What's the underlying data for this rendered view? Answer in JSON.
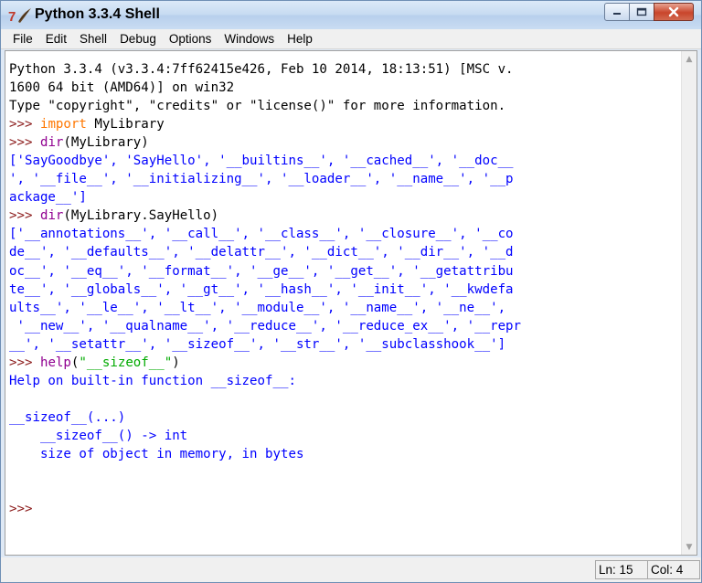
{
  "window": {
    "title": "Python 3.3.4 Shell",
    "icon": "python-tk-feather-icon",
    "controls": [
      "minimize-icon",
      "maximize-icon",
      "close-icon"
    ]
  },
  "menu": [
    "File",
    "Edit",
    "Shell",
    "Debug",
    "Options",
    "Windows",
    "Help"
  ],
  "colors": {
    "keyword": "#ff7700",
    "builtin": "#900090",
    "string": "#00aa00",
    "stdout": "#0000ff",
    "prompt": "#8b1a1a"
  },
  "console": {
    "lines": [
      [
        {
          "t": "Python 3.3.4 (v3.3.4:7ff62415e426, Feb 10 2014, 18:13:51) [MSC v.",
          "c": "default"
        }
      ],
      [
        {
          "t": "1600 64 bit (AMD64)] on win32",
          "c": "default"
        }
      ],
      [
        {
          "t": "Type \"copyright\", \"credits\" or \"license()\" for more information.",
          "c": "default"
        }
      ],
      [
        {
          "t": ">>> ",
          "c": "prompt"
        },
        {
          "t": "import",
          "c": "kw"
        },
        {
          "t": " MyLibrary",
          "c": "default"
        }
      ],
      [
        {
          "t": ">>> ",
          "c": "prompt"
        },
        {
          "t": "dir",
          "c": "builtin"
        },
        {
          "t": "(MyLibrary)",
          "c": "default"
        }
      ],
      [
        {
          "t": "['SayGoodbye', 'SayHello', '__builtins__', '__cached__', '__doc__",
          "c": "stdout"
        }
      ],
      [
        {
          "t": "', '__file__', '__initializing__', '__loader__', '__name__', '__p",
          "c": "stdout"
        }
      ],
      [
        {
          "t": "ackage__']",
          "c": "stdout"
        }
      ],
      [
        {
          "t": ">>> ",
          "c": "prompt"
        },
        {
          "t": "dir",
          "c": "builtin"
        },
        {
          "t": "(MyLibrary.SayHello)",
          "c": "default"
        }
      ],
      [
        {
          "t": "['__annotations__', '__call__', '__class__', '__closure__', '__co",
          "c": "stdout"
        }
      ],
      [
        {
          "t": "de__', '__defaults__', '__delattr__', '__dict__', '__dir__', '__d",
          "c": "stdout"
        }
      ],
      [
        {
          "t": "oc__', '__eq__', '__format__', '__ge__', '__get__', '__getattribu",
          "c": "stdout"
        }
      ],
      [
        {
          "t": "te__', '__globals__', '__gt__', '__hash__', '__init__', '__kwdefa",
          "c": "stdout"
        }
      ],
      [
        {
          "t": "ults__', '__le__', '__lt__', '__module__', '__name__', '__ne__',",
          "c": "stdout"
        }
      ],
      [
        {
          "t": " '__new__', '__qualname__', '__reduce__', '__reduce_ex__', '__repr",
          "c": "stdout"
        }
      ],
      [
        {
          "t": "__', '__setattr__', '__sizeof__', '__str__', '__subclasshook__']",
          "c": "stdout"
        }
      ],
      [
        {
          "t": ">>> ",
          "c": "prompt"
        },
        {
          "t": "help",
          "c": "builtin"
        },
        {
          "t": "(",
          "c": "default"
        },
        {
          "t": "\"__sizeof__\"",
          "c": "string"
        },
        {
          "t": ")",
          "c": "default"
        }
      ],
      [
        {
          "t": "Help on built-in function __sizeof__:",
          "c": "stdout"
        }
      ],
      [
        {
          "t": "",
          "c": "stdout"
        }
      ],
      [
        {
          "t": "__sizeof__(...)",
          "c": "stdout"
        }
      ],
      [
        {
          "t": "    __sizeof__() -> int",
          "c": "stdout"
        }
      ],
      [
        {
          "t": "    size of object in memory, in bytes",
          "c": "stdout"
        }
      ],
      [
        {
          "t": "",
          "c": "stdout"
        }
      ],
      [
        {
          "t": "",
          "c": "stdout"
        }
      ],
      [
        {
          "t": ">>> ",
          "c": "prompt"
        }
      ]
    ]
  },
  "status": {
    "ln": "Ln: 15",
    "col": "Col: 4"
  }
}
